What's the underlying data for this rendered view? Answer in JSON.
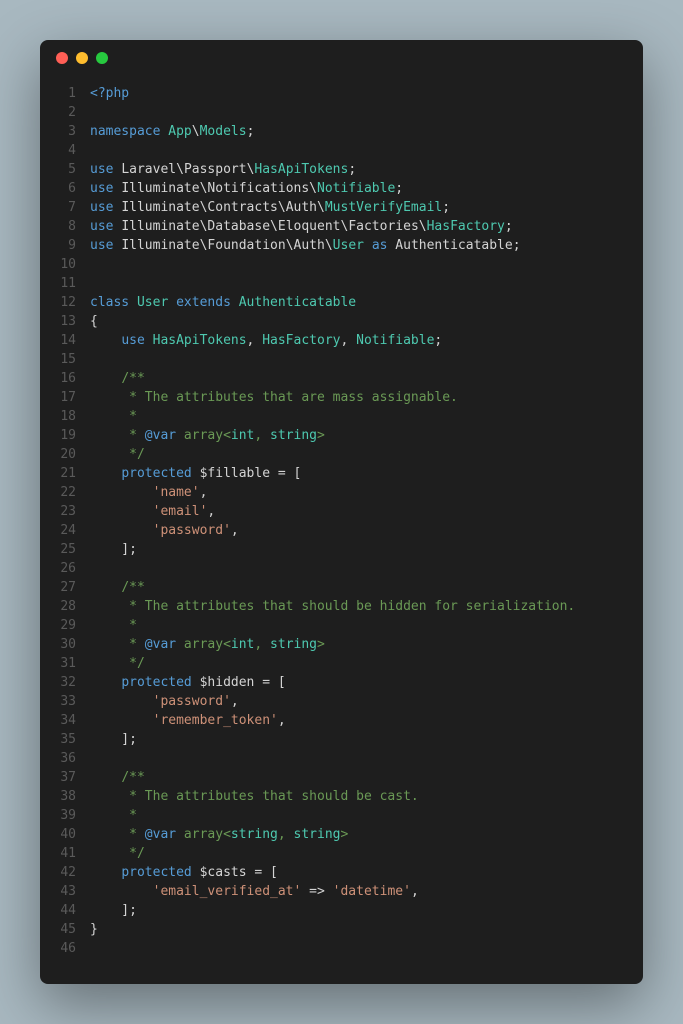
{
  "window": {
    "traffic_lights": [
      "close",
      "minimize",
      "zoom"
    ]
  },
  "code": {
    "line_count": 46,
    "lines": [
      [
        [
          "kw",
          "<?php"
        ]
      ],
      [],
      [
        [
          "kw",
          "namespace"
        ],
        [
          "pl",
          " "
        ],
        [
          "cls",
          "App"
        ],
        [
          "pl",
          "\\"
        ],
        [
          "cls",
          "Models"
        ],
        [
          "pl",
          ";"
        ]
      ],
      [],
      [
        [
          "kw",
          "use"
        ],
        [
          "pl",
          " "
        ],
        [
          "ns",
          "Laravel"
        ],
        [
          "pl",
          "\\"
        ],
        [
          "ns",
          "Passport"
        ],
        [
          "pl",
          "\\"
        ],
        [
          "cls",
          "HasApiTokens"
        ],
        [
          "pl",
          ";"
        ]
      ],
      [
        [
          "kw",
          "use"
        ],
        [
          "pl",
          " "
        ],
        [
          "ns",
          "Illuminate"
        ],
        [
          "pl",
          "\\"
        ],
        [
          "ns",
          "Notifications"
        ],
        [
          "pl",
          "\\"
        ],
        [
          "cls",
          "Notifiable"
        ],
        [
          "pl",
          ";"
        ]
      ],
      [
        [
          "kw",
          "use"
        ],
        [
          "pl",
          " "
        ],
        [
          "ns",
          "Illuminate"
        ],
        [
          "pl",
          "\\"
        ],
        [
          "ns",
          "Contracts"
        ],
        [
          "pl",
          "\\"
        ],
        [
          "ns",
          "Auth"
        ],
        [
          "pl",
          "\\"
        ],
        [
          "cls",
          "MustVerifyEmail"
        ],
        [
          "pl",
          ";"
        ]
      ],
      [
        [
          "kw",
          "use"
        ],
        [
          "pl",
          " "
        ],
        [
          "ns",
          "Illuminate"
        ],
        [
          "pl",
          "\\"
        ],
        [
          "ns",
          "Database"
        ],
        [
          "pl",
          "\\"
        ],
        [
          "ns",
          "Eloquent"
        ],
        [
          "pl",
          "\\"
        ],
        [
          "ns",
          "Factories"
        ],
        [
          "pl",
          "\\"
        ],
        [
          "cls",
          "HasFactory"
        ],
        [
          "pl",
          ";"
        ]
      ],
      [
        [
          "kw",
          "use"
        ],
        [
          "pl",
          " "
        ],
        [
          "ns",
          "Illuminate"
        ],
        [
          "pl",
          "\\"
        ],
        [
          "ns",
          "Foundation"
        ],
        [
          "pl",
          "\\"
        ],
        [
          "ns",
          "Auth"
        ],
        [
          "pl",
          "\\"
        ],
        [
          "cls",
          "User"
        ],
        [
          "pl",
          " "
        ],
        [
          "kw",
          "as"
        ],
        [
          "pl",
          " "
        ],
        [
          "ns",
          "Authenticatable"
        ],
        [
          "pl",
          ";"
        ]
      ],
      [],
      [],
      [
        [
          "kw",
          "class"
        ],
        [
          "pl",
          " "
        ],
        [
          "cls",
          "User"
        ],
        [
          "pl",
          " "
        ],
        [
          "kw",
          "extends"
        ],
        [
          "pl",
          " "
        ],
        [
          "cls",
          "Authenticatable"
        ]
      ],
      [
        [
          "pl",
          "{"
        ]
      ],
      [
        [
          "pl",
          "    "
        ],
        [
          "kw",
          "use"
        ],
        [
          "pl",
          " "
        ],
        [
          "cls",
          "HasApiTokens"
        ],
        [
          "pl",
          ", "
        ],
        [
          "cls",
          "HasFactory"
        ],
        [
          "pl",
          ", "
        ],
        [
          "cls",
          "Notifiable"
        ],
        [
          "pl",
          ";"
        ]
      ],
      [],
      [
        [
          "pl",
          "    "
        ],
        [
          "cmt",
          "/**"
        ]
      ],
      [
        [
          "pl",
          "    "
        ],
        [
          "cmt",
          " * The attributes that are mass assignable."
        ]
      ],
      [
        [
          "pl",
          "    "
        ],
        [
          "cmt",
          " *"
        ]
      ],
      [
        [
          "pl",
          "    "
        ],
        [
          "cmt",
          " * "
        ],
        [
          "kw",
          "@var"
        ],
        [
          "cmt",
          " array<"
        ],
        [
          "type",
          "int"
        ],
        [
          "cmt",
          ", "
        ],
        [
          "type",
          "string"
        ],
        [
          "cmt",
          ">"
        ]
      ],
      [
        [
          "pl",
          "    "
        ],
        [
          "cmt",
          " */"
        ]
      ],
      [
        [
          "pl",
          "    "
        ],
        [
          "kw",
          "protected"
        ],
        [
          "pl",
          " "
        ],
        [
          "var",
          "$fillable"
        ],
        [
          "pl",
          " = ["
        ]
      ],
      [
        [
          "pl",
          "        "
        ],
        [
          "str",
          "'name'"
        ],
        [
          "pl",
          ","
        ]
      ],
      [
        [
          "pl",
          "        "
        ],
        [
          "str",
          "'email'"
        ],
        [
          "pl",
          ","
        ]
      ],
      [
        [
          "pl",
          "        "
        ],
        [
          "str",
          "'password'"
        ],
        [
          "pl",
          ","
        ]
      ],
      [
        [
          "pl",
          "    ];"
        ]
      ],
      [],
      [
        [
          "pl",
          "    "
        ],
        [
          "cmt",
          "/**"
        ]
      ],
      [
        [
          "pl",
          "    "
        ],
        [
          "cmt",
          " * The attributes that should be hidden for serialization."
        ]
      ],
      [
        [
          "pl",
          "    "
        ],
        [
          "cmt",
          " *"
        ]
      ],
      [
        [
          "pl",
          "    "
        ],
        [
          "cmt",
          " * "
        ],
        [
          "kw",
          "@var"
        ],
        [
          "cmt",
          " array<"
        ],
        [
          "type",
          "int"
        ],
        [
          "cmt",
          ", "
        ],
        [
          "type",
          "string"
        ],
        [
          "cmt",
          ">"
        ]
      ],
      [
        [
          "pl",
          "    "
        ],
        [
          "cmt",
          " */"
        ]
      ],
      [
        [
          "pl",
          "    "
        ],
        [
          "kw",
          "protected"
        ],
        [
          "pl",
          " "
        ],
        [
          "var",
          "$hidden"
        ],
        [
          "pl",
          " = ["
        ]
      ],
      [
        [
          "pl",
          "        "
        ],
        [
          "str",
          "'password'"
        ],
        [
          "pl",
          ","
        ]
      ],
      [
        [
          "pl",
          "        "
        ],
        [
          "str",
          "'remember_token'"
        ],
        [
          "pl",
          ","
        ]
      ],
      [
        [
          "pl",
          "    ];"
        ]
      ],
      [],
      [
        [
          "pl",
          "    "
        ],
        [
          "cmt",
          "/**"
        ]
      ],
      [
        [
          "pl",
          "    "
        ],
        [
          "cmt",
          " * The attributes that should be cast."
        ]
      ],
      [
        [
          "pl",
          "    "
        ],
        [
          "cmt",
          " *"
        ]
      ],
      [
        [
          "pl",
          "    "
        ],
        [
          "cmt",
          " * "
        ],
        [
          "kw",
          "@var"
        ],
        [
          "cmt",
          " array<"
        ],
        [
          "type",
          "string"
        ],
        [
          "cmt",
          ", "
        ],
        [
          "type",
          "string"
        ],
        [
          "cmt",
          ">"
        ]
      ],
      [
        [
          "pl",
          "    "
        ],
        [
          "cmt",
          " */"
        ]
      ],
      [
        [
          "pl",
          "    "
        ],
        [
          "kw",
          "protected"
        ],
        [
          "pl",
          " "
        ],
        [
          "var",
          "$casts"
        ],
        [
          "pl",
          " = ["
        ]
      ],
      [
        [
          "pl",
          "        "
        ],
        [
          "str",
          "'email_verified_at'"
        ],
        [
          "pl",
          " => "
        ],
        [
          "str",
          "'datetime'"
        ],
        [
          "pl",
          ","
        ]
      ],
      [
        [
          "pl",
          "    ];"
        ]
      ],
      [
        [
          "pl",
          "}"
        ]
      ],
      []
    ]
  }
}
